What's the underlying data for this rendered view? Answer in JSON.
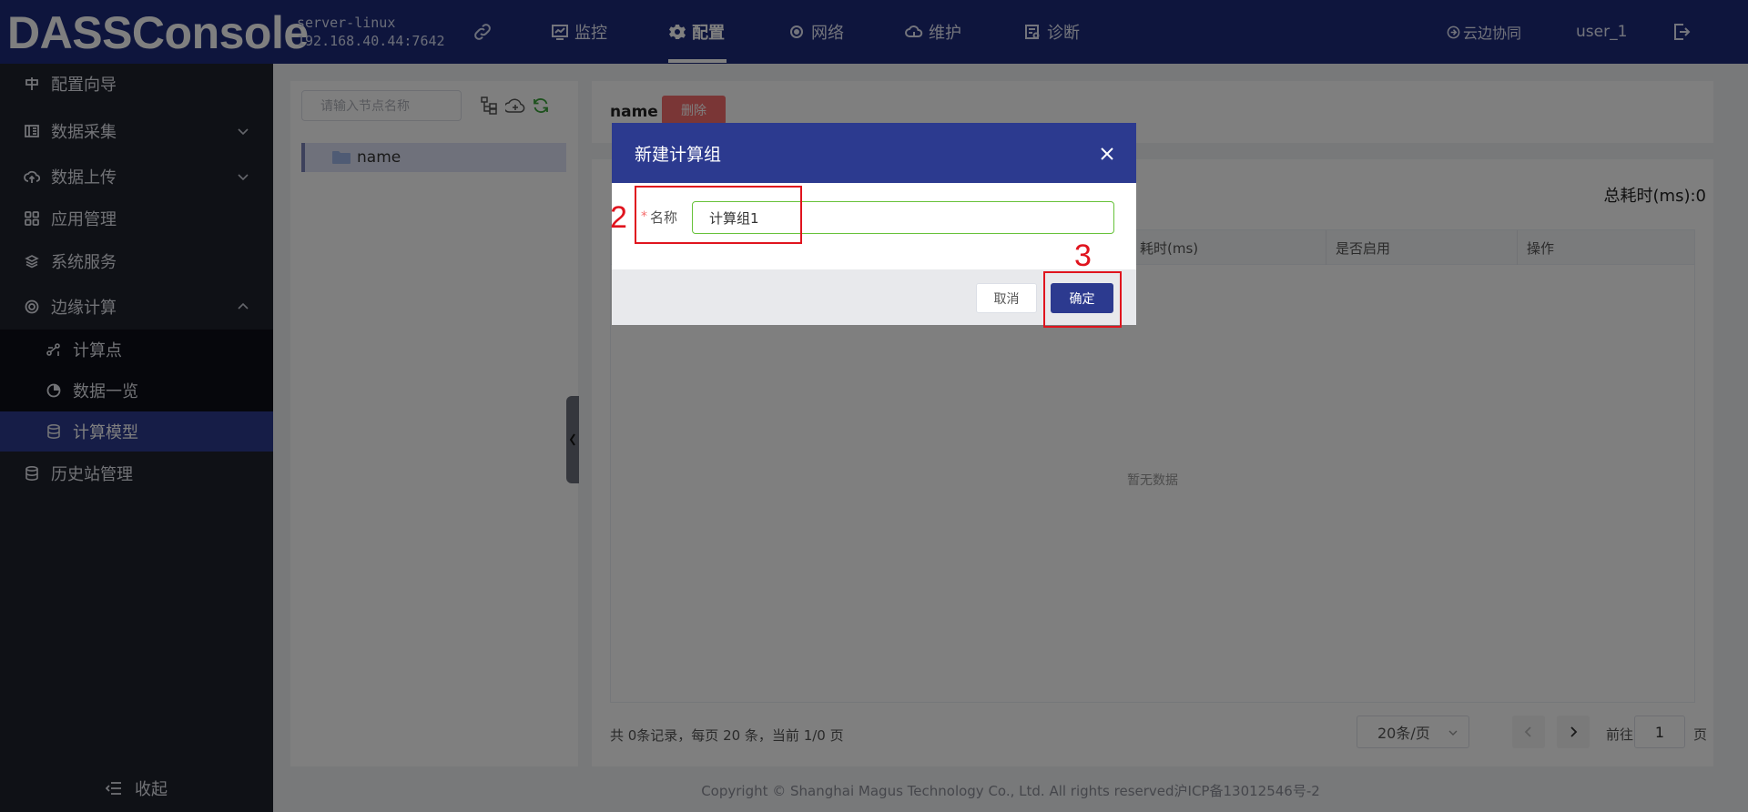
{
  "header": {
    "brand": "DASSConsole",
    "server_name": "server-linux",
    "server_address": "192.168.40.44:7642",
    "nav": [
      {
        "label": "监控",
        "icon": "monitor-icon",
        "active": false
      },
      {
        "label": "配置",
        "icon": "settings-gear-icon",
        "active": true
      },
      {
        "label": "网络",
        "icon": "network-icon",
        "active": false
      },
      {
        "label": "维护",
        "icon": "cloud-maintain-icon",
        "active": false
      },
      {
        "label": "诊断",
        "icon": "diagnose-icon",
        "active": false
      }
    ],
    "cloud_sync": "云边协同",
    "user": "user_1"
  },
  "sidebar": {
    "items": [
      {
        "label": "配置向导",
        "icon": "guide-icon"
      },
      {
        "label": "数据采集",
        "icon": "data-collect-icon",
        "expandable": true
      },
      {
        "label": "数据上传",
        "icon": "cloud-upload-icon",
        "expandable": true
      },
      {
        "label": "应用管理",
        "icon": "apps-grid-icon"
      },
      {
        "label": "系统服务",
        "icon": "layers-icon"
      },
      {
        "label": "边缘计算",
        "icon": "edge-compute-icon",
        "expanded": true
      },
      {
        "label": "历史站管理",
        "icon": "database-icon"
      }
    ],
    "sub_items": [
      {
        "label": "计算点",
        "icon": "compute-point-icon"
      },
      {
        "label": "数据一览",
        "icon": "pie-icon"
      },
      {
        "label": "计算模型",
        "icon": "database-icon",
        "active": true
      }
    ],
    "collapse_label": "收起"
  },
  "tree": {
    "search_placeholder": "请输入节点名称",
    "node_label": "name"
  },
  "detail": {
    "name": "name",
    "delete_label": "删除",
    "total_time": "总耗时(ms):0",
    "columns": [
      "耗时(ms)",
      "是否启用",
      "操作"
    ],
    "empty_text": "暂无数据",
    "footer_info": "共 0条记录，每页 20 条，当前 1/0 页",
    "page_size": "20条/页",
    "goto_label": "前往",
    "goto_value": "1",
    "goto_suffix": "页"
  },
  "copyright": "Copyright © Shanghai Magus Technology Co., Ltd. All rights reserved沪ICP备13012546号-2",
  "modal": {
    "title": "新建计算组",
    "required_mark": "*",
    "name_label": "名称",
    "name_value": "计算组1",
    "cancel_label": "取消",
    "ok_label": "确定"
  },
  "annotations": {
    "step2": "2",
    "step3": "3"
  },
  "colors": {
    "header_bg": "#1c2a7a",
    "sidebar_bg": "#1e222d",
    "primary": "#2c3a8f",
    "danger": "#f56c6c",
    "annotation": "#e0141e",
    "input_valid": "#67c23a"
  }
}
